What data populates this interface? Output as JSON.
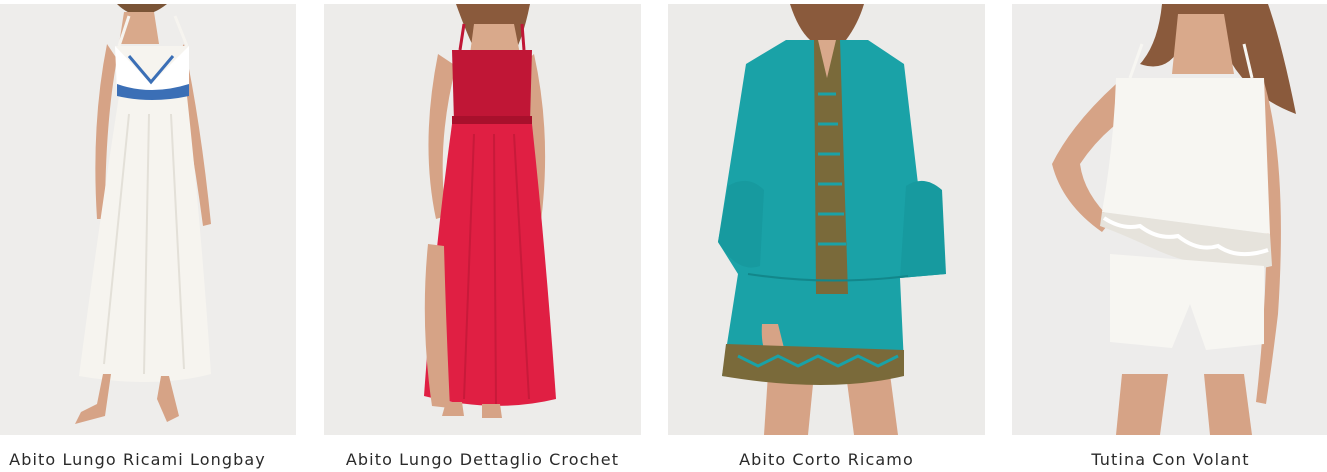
{
  "products": [
    {
      "title": "Abito Lungo Ricami Longbay",
      "garment_color": "#f6f4ef",
      "accent_color": "#3b6fb6",
      "background_color": "#ecebe9"
    },
    {
      "title": "Abito Lungo Dettaglio Crochet",
      "garment_color": "#e01f43",
      "accent_color": "#c01636",
      "background_color": "#edecea"
    },
    {
      "title": "Abito Corto Ricamo",
      "garment_color": "#1aa2a7",
      "accent_color": "#7a6a3a",
      "background_color": "#ecebe9"
    },
    {
      "title": "Tutina Con Volant",
      "garment_color": "#f7f6f2",
      "accent_color": "#e6e3dc",
      "background_color": "#edeceb"
    }
  ]
}
